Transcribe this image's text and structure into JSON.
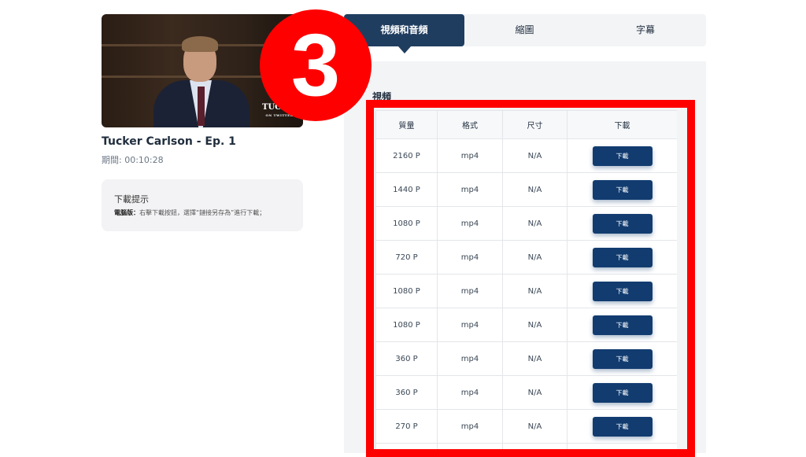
{
  "video": {
    "title": "Tucker Carlson - Ep. 1",
    "duration": "期間: 00:10:28",
    "thumbnail_logo": "TUCKER",
    "thumbnail_logo_sub": "ON TWITTER"
  },
  "tip": {
    "title": "下載提示",
    "label": "電腦版：",
    "text": "右擊下載按鈕，選擇“鏈接另存為”進行下載；"
  },
  "tabs": [
    {
      "label": "視頻和音頻",
      "active": true
    },
    {
      "label": "縮圖",
      "active": false
    },
    {
      "label": "字幕",
      "active": false
    }
  ],
  "section_label": "視頻",
  "table": {
    "headers": [
      "質量",
      "格式",
      "尺寸",
      "下載"
    ],
    "button_label": "下載",
    "rows": [
      {
        "quality": "2160 P",
        "format": "mp4",
        "size": "N/A"
      },
      {
        "quality": "1440 P",
        "format": "mp4",
        "size": "N/A"
      },
      {
        "quality": "1080 P",
        "format": "mp4",
        "size": "N/A"
      },
      {
        "quality": "720 P",
        "format": "mp4",
        "size": "N/A"
      },
      {
        "quality": "1080 P",
        "format": "mp4",
        "size": "N/A"
      },
      {
        "quality": "1080 P",
        "format": "mp4",
        "size": "N/A"
      },
      {
        "quality": "360 P",
        "format": "mp4",
        "size": "N/A"
      },
      {
        "quality": "360 P",
        "format": "mp4",
        "size": "N/A"
      },
      {
        "quality": "270 P",
        "format": "mp4",
        "size": "N/A"
      },
      {
        "quality": "",
        "format": "",
        "size": ""
      }
    ]
  },
  "annotation": {
    "step_number": "3",
    "colors": {
      "highlight": "#ff0000",
      "accent": "#1f3d5f",
      "button": "#123c70"
    }
  }
}
